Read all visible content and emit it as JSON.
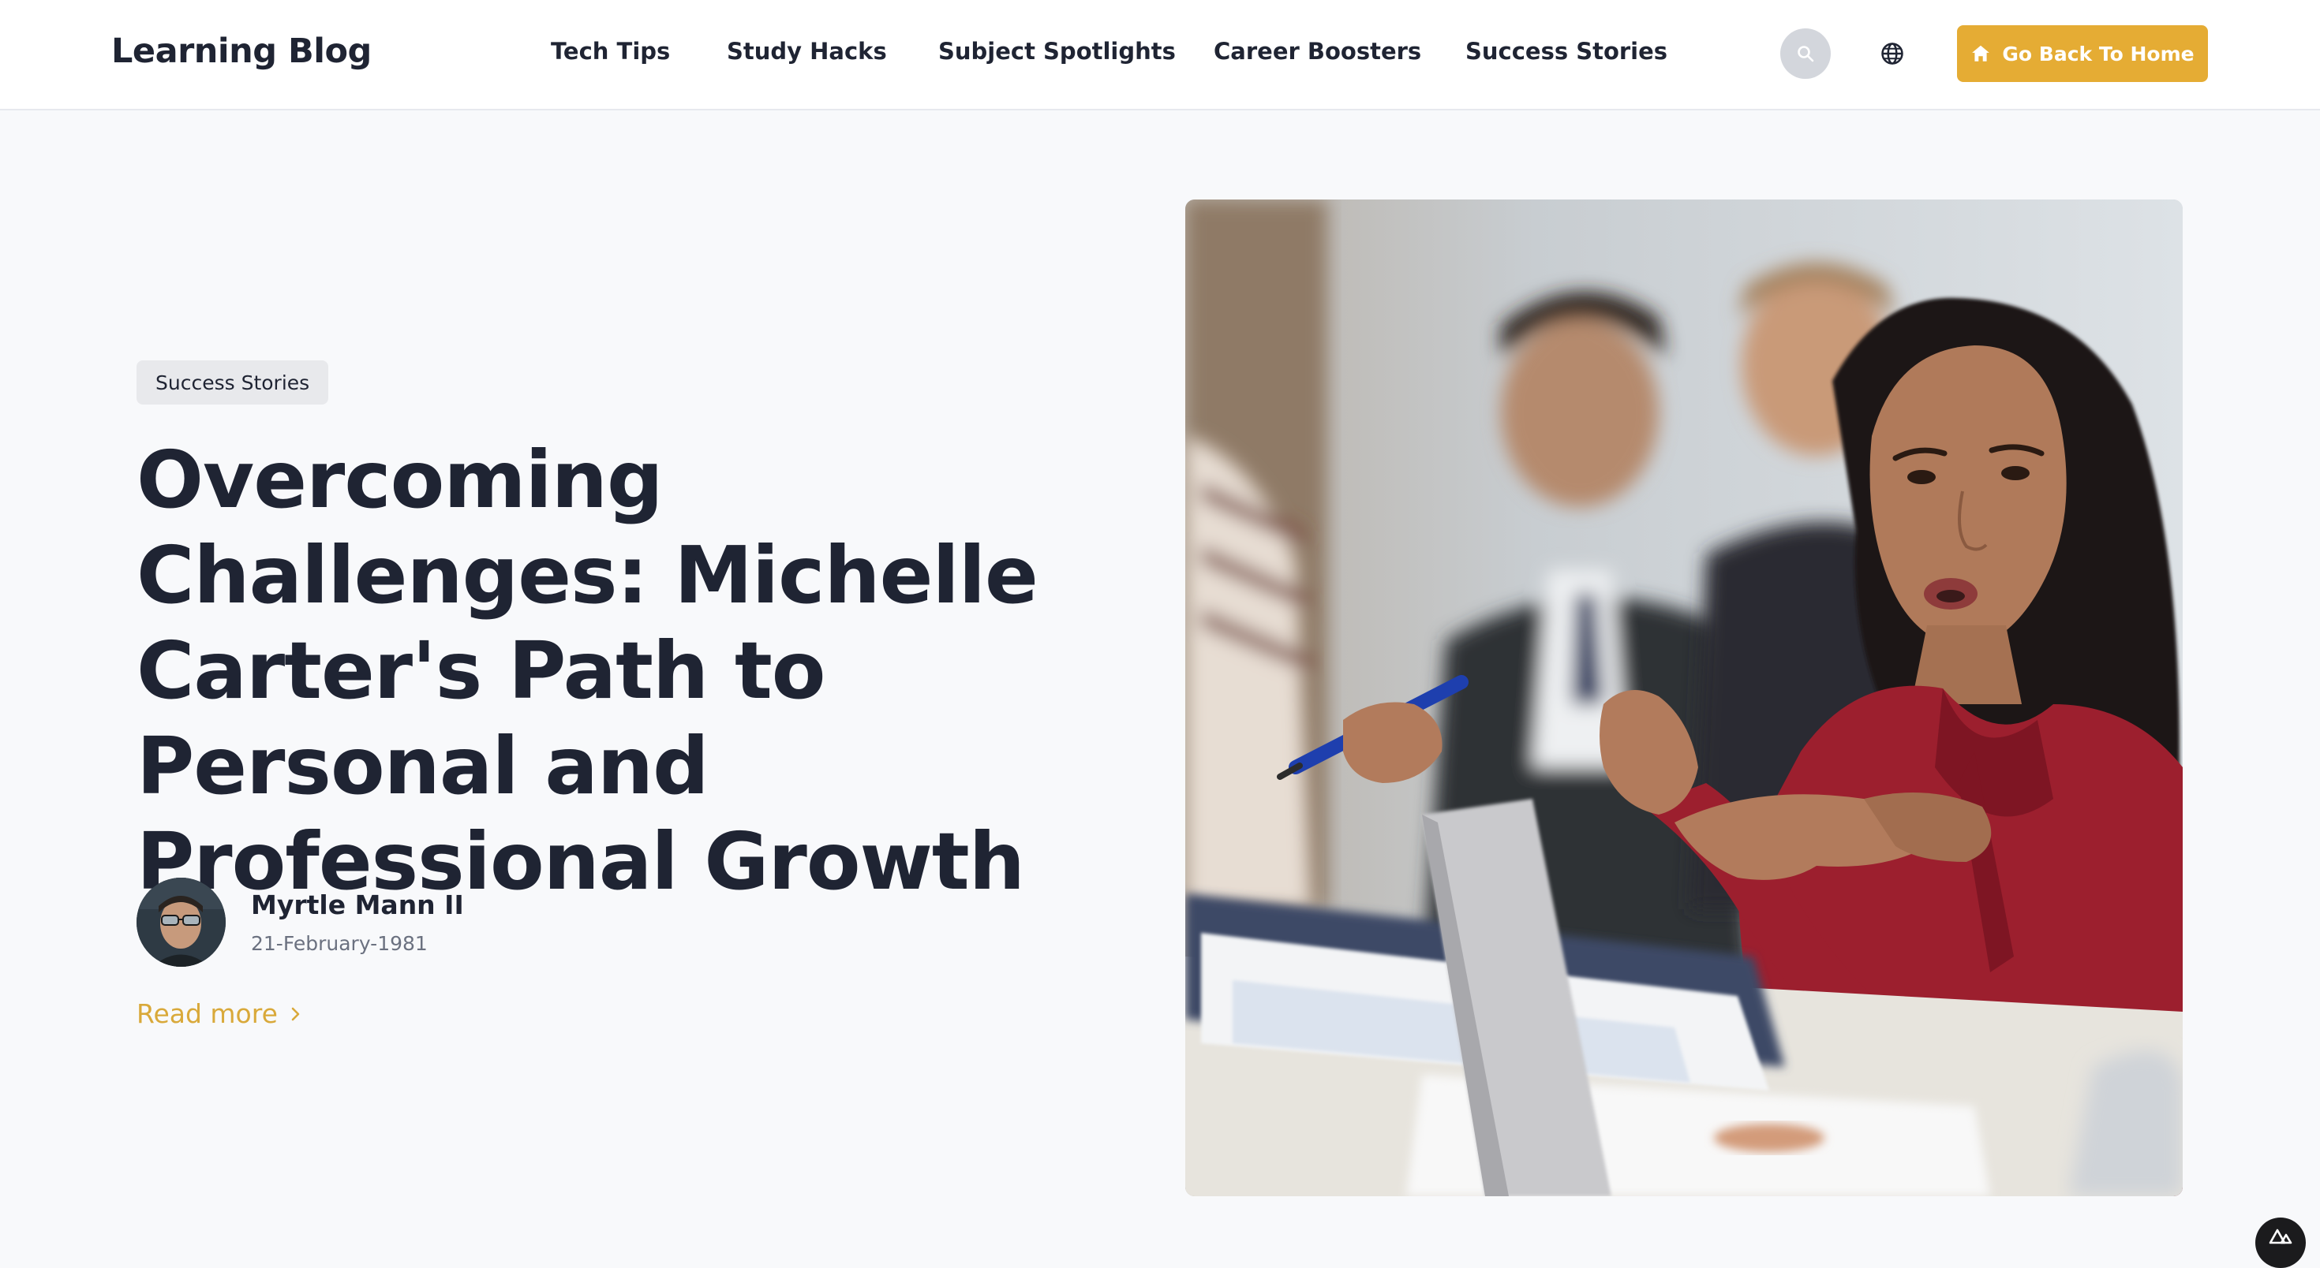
{
  "header": {
    "logo": "Learning Blog",
    "nav": [
      {
        "label": "Tech Tips"
      },
      {
        "label": "Study Hacks"
      },
      {
        "label": "Subject Spotlights"
      },
      {
        "label": "Career Boosters"
      },
      {
        "label": "Success Stories"
      }
    ],
    "search_icon": "search-icon",
    "language_icon": "globe-icon",
    "home_button": {
      "label": "Go Back To Home",
      "icon": "home-icon"
    }
  },
  "hero": {
    "category": "Success Stories",
    "title": "Overcoming Challenges: Michelle Carter's Path to Personal and Professional Growth",
    "author": {
      "name": "Myrtle Mann II",
      "date": "21-February-1981"
    },
    "read_more": "Read more",
    "image_alt": "Woman in red blouse speaking during a meeting"
  },
  "colors": {
    "accent": "#e5ac34",
    "read_more": "#d9a93a",
    "heading": "#1f2433",
    "page_bg": "#f8f9fb",
    "header_bg": "#ffffff"
  }
}
